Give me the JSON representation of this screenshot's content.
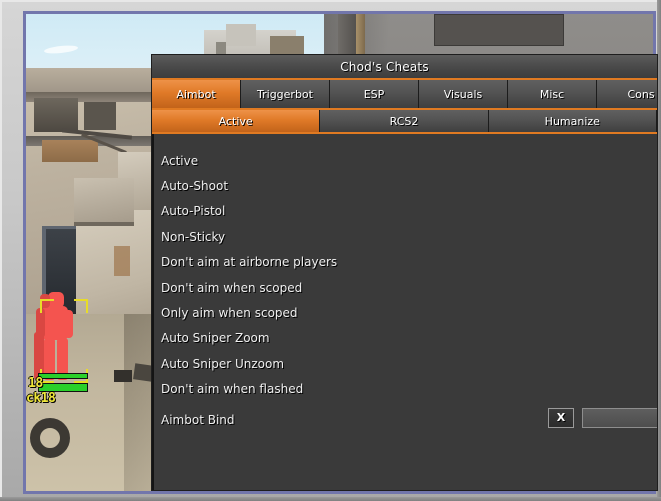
{
  "window": {
    "frame_color": "#c8c8c8",
    "inner_border_color": "#7276ac"
  },
  "game": {
    "map_style": "dust2-style desert map",
    "esp": {
      "player_name_line1": "18",
      "player_name_line2": "ck18",
      "box_color": "#e8dc28",
      "chams_color": "#f4544f",
      "health_color": "#2ad02a"
    }
  },
  "menu": {
    "title": "Chod's Cheats",
    "accent_color": "#e07a22",
    "tabs": [
      {
        "label": "Aimbot",
        "selected": true
      },
      {
        "label": "Triggerbot",
        "selected": false
      },
      {
        "label": "ESP",
        "selected": false
      },
      {
        "label": "Visuals",
        "selected": false
      },
      {
        "label": "Misc",
        "selected": false
      },
      {
        "label": "Cons",
        "selected": false
      }
    ],
    "subtabs": [
      {
        "label": "Active",
        "selected": true
      },
      {
        "label": "RCS2",
        "selected": false
      },
      {
        "label": "Humanize",
        "selected": false
      }
    ],
    "options": [
      {
        "label": "Active"
      },
      {
        "label": "Auto-Shoot"
      },
      {
        "label": "Auto-Pistol"
      },
      {
        "label": "Non-Sticky"
      },
      {
        "label": "Don't aim at airborne players"
      },
      {
        "label": "Don't aim when scoped"
      },
      {
        "label": "Only aim when scoped"
      },
      {
        "label": "Auto Sniper Zoom"
      },
      {
        "label": "Auto Sniper Unzoom"
      },
      {
        "label": "Don't aim when flashed"
      }
    ],
    "bind": {
      "label": "Aimbot Bind",
      "clear_button": "X",
      "value": "",
      "placeholder": ""
    }
  }
}
